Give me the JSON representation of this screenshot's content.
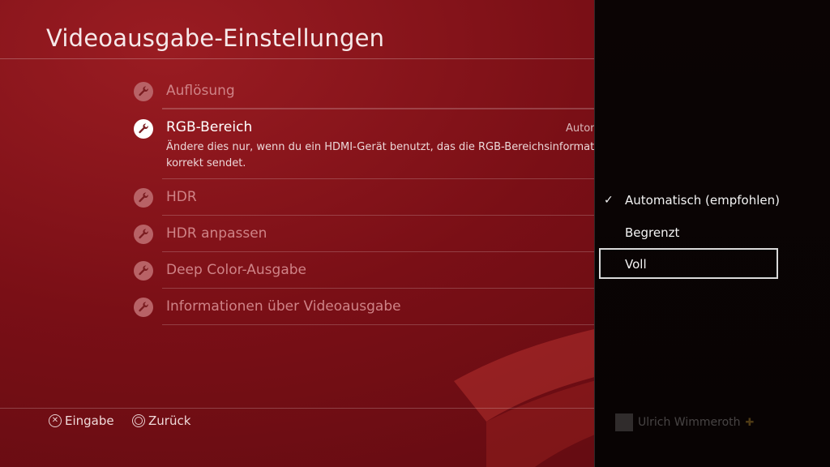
{
  "screen": {
    "title": "Videoausgabe-Einstellungen"
  },
  "menu": {
    "items": [
      {
        "label": "Auflösung",
        "icon": "wrench-icon"
      },
      {
        "label": "RGB-Bereich",
        "icon": "wrench-icon",
        "value": "Automatisch (empfohlen)",
        "description": "Ändere dies nur, wenn du ein HDMI-Gerät benutzt, das die RGB-Bereichsinformationen nicht korrekt sendet."
      },
      {
        "label": "HDR",
        "icon": "wrench-icon"
      },
      {
        "label": "HDR anpassen",
        "icon": "wrench-icon"
      },
      {
        "label": "Deep Color-Ausgabe",
        "icon": "wrench-icon"
      },
      {
        "label": "Informationen über Videoausgabe",
        "icon": "wrench-icon"
      }
    ]
  },
  "footer": {
    "enter_label": "Eingabe",
    "back_label": "Zurück",
    "enter_icon": "cross-button-icon",
    "back_icon": "circle-button-icon"
  },
  "options_panel": {
    "options": [
      {
        "label": "Automatisch (empfohlen)",
        "selected": true
      },
      {
        "label": "Begrenzt",
        "selected": false
      },
      {
        "label": "Voll",
        "selected": false,
        "focused": true
      }
    ],
    "user_name": "Ulrich Wimmeroth"
  },
  "colors": {
    "background": "#7a0f16",
    "panel": "#080303",
    "focus_frame": "#d9d9d9"
  }
}
